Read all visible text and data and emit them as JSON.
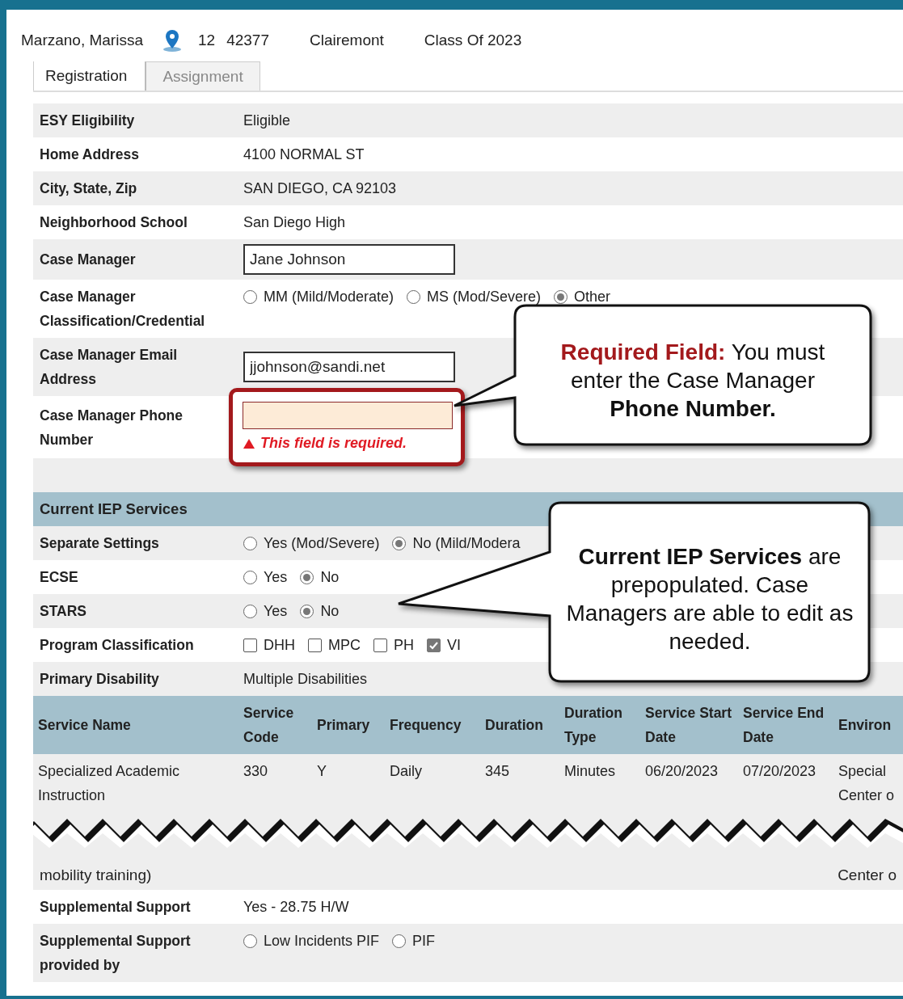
{
  "student": {
    "name": "Marzano, Marissa",
    "grade": "12",
    "id": "42377",
    "school": "Clairemont",
    "class_of": "Class Of 2023"
  },
  "tabs": [
    {
      "label": "Registration",
      "selected": true
    },
    {
      "label": "Assignment",
      "selected": false
    }
  ],
  "fields": [
    {
      "kind": "text",
      "label": "ESY Eligibility",
      "value": "Eligible"
    },
    {
      "kind": "text",
      "label": "Home Address",
      "value": "4100 NORMAL ST"
    },
    {
      "kind": "text",
      "label": "City, State, Zip",
      "value": "SAN DIEGO, CA 92103"
    },
    {
      "kind": "text",
      "label": "Neighborhood School",
      "value": "San Diego High"
    },
    {
      "kind": "input",
      "label": "Case Manager",
      "value": "Jane Johnson"
    },
    {
      "kind": "radio",
      "label": "Case Manager Classification/Credential",
      "options": [
        {
          "label": "MM (Mild/Moderate)",
          "selected": false
        },
        {
          "label": "MS (Mod/Severe)",
          "selected": false
        },
        {
          "label": "Other",
          "selected": true
        }
      ]
    },
    {
      "kind": "input",
      "label": "Case Manager Email Address",
      "value": "jjohnson@sandi.net"
    },
    {
      "kind": "required_input",
      "label": "Case Manager Phone Number",
      "error": "This field is required."
    }
  ],
  "services": {
    "title": "Current IEP Services",
    "fields": [
      {
        "kind": "radio",
        "label": "Separate Settings",
        "options": [
          {
            "label": "Yes (Mod/Severe)",
            "selected": false
          },
          {
            "label": "No (Mild/Modera",
            "selected": true
          }
        ]
      },
      {
        "kind": "radio",
        "label": "ECSE",
        "options": [
          {
            "label": "Yes",
            "selected": false
          },
          {
            "label": "No",
            "selected": true
          }
        ]
      },
      {
        "kind": "radio",
        "label": "STARS",
        "options": [
          {
            "label": "Yes",
            "selected": false
          },
          {
            "label": "No",
            "selected": true
          }
        ]
      },
      {
        "kind": "checkbox",
        "label": "Program Classification",
        "options": [
          {
            "label": "DHH",
            "checked": false
          },
          {
            "label": "MPC",
            "checked": false
          },
          {
            "label": "PH",
            "checked": false
          },
          {
            "label": "VI",
            "checked": true
          }
        ]
      },
      {
        "kind": "text",
        "label": "Primary Disability",
        "value": "Multiple Disabilities"
      }
    ],
    "table": {
      "columns": [
        "Service Name",
        "Service Code",
        "Primary",
        "Frequency",
        "Duration",
        "Duration Type",
        "Service Start Date",
        "Service End Date",
        "Environ"
      ],
      "rows": [
        [
          "Specialized Academic Instruction",
          "330",
          "Y",
          "Daily",
          "345",
          "Minutes",
          "06/20/2023",
          "07/20/2023",
          "Special\nCenter o"
        ]
      ],
      "torn_row_tail": {
        "first": "mobility training)",
        "last": "Center o"
      }
    }
  },
  "more_fields": [
    {
      "kind": "text",
      "label": "Supplemental Support",
      "value": "Yes - 28.75 H/W"
    },
    {
      "kind": "radio",
      "label": "Supplemental Support provided by",
      "options": [
        {
          "label": "Low Incidents PIF",
          "selected": false
        },
        {
          "label": "PIF",
          "selected": false
        }
      ]
    }
  ],
  "callouts": [
    {
      "lead": "Required Field:",
      "text": "You must enter the Case Manager **Phone Number.**"
    },
    {
      "text": "**Current IEP Services** are prepopulated. Case Managers are able to edit as needed."
    }
  ]
}
